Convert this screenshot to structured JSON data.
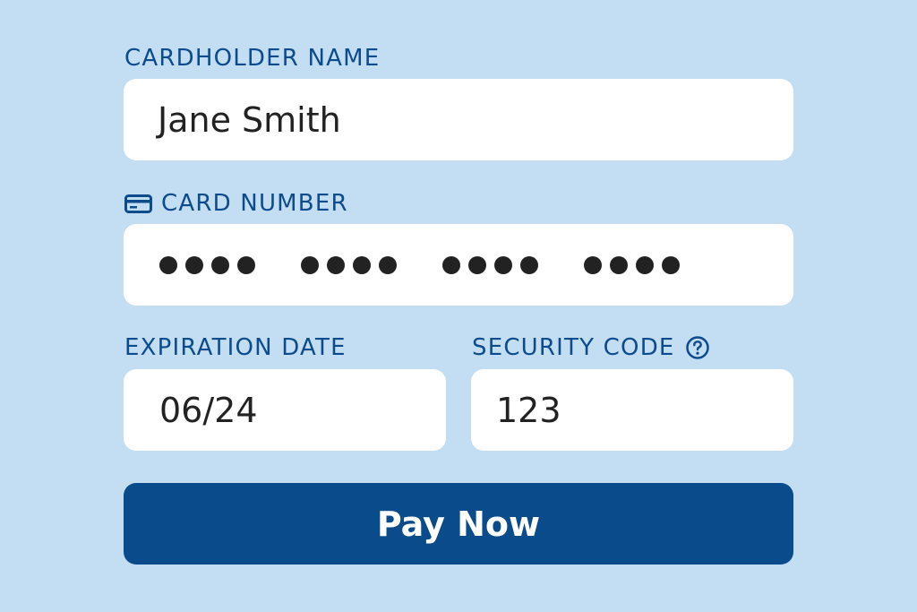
{
  "cardholder": {
    "label": "CARDHOLDER NAME",
    "value": "Jane Smith"
  },
  "card_number": {
    "label": "CARD NUMBER",
    "icon": "credit-card-icon",
    "masked_groups": 4,
    "digits_per_group": 4
  },
  "expiration": {
    "label": "EXPIRATION DATE",
    "value": "06/24"
  },
  "security_code": {
    "label": "SECURITY CODE",
    "help_icon": "question-circle-icon",
    "value": "123"
  },
  "submit": {
    "label": "Pay Now"
  },
  "colors": {
    "background": "#c3ddf3",
    "accent": "#0a4b8c",
    "field_bg": "#ffffff",
    "text": "#222222"
  }
}
